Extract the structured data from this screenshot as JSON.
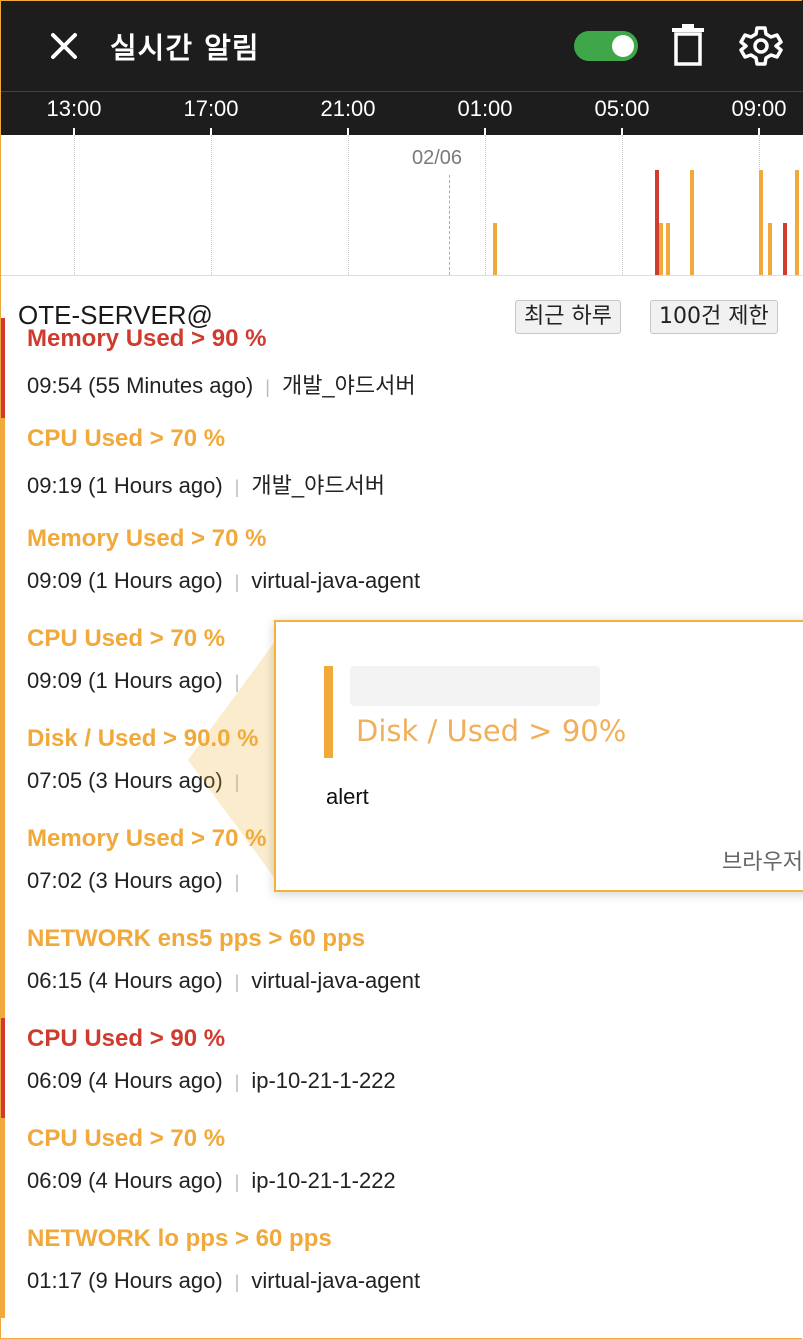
{
  "header": {
    "title": "실시간 알림",
    "close_icon": "close-icon",
    "toggle_on": true,
    "trash_icon": "trash-icon",
    "settings_icon": "gear-icon"
  },
  "timeline": {
    "ticks": [
      "13:00",
      "17:00",
      "21:00",
      "01:00",
      "05:00",
      "09:00"
    ],
    "date_marker": "02/06",
    "colors": {
      "warning": "#f0a93a",
      "critical": "#cf3b2f"
    }
  },
  "server": {
    "name": "OTE-SERVER@",
    "range_button": "최근 하루",
    "limit_button": "100건 제한"
  },
  "alerts": [
    {
      "title": "Memory Used > 90 %",
      "time": "09:54 (55 Minutes ago)",
      "source": "개발_야드서버",
      "level": "critical"
    },
    {
      "title": "CPU Used > 70 %",
      "time": "09:19 (1 Hours ago)",
      "source": "개발_야드서버",
      "level": "warning"
    },
    {
      "title": "Memory Used > 70 %",
      "time": "09:09 (1 Hours ago)",
      "source": "virtual-java-agent",
      "level": "warning"
    },
    {
      "title": "CPU Used > 70 %",
      "time": "09:09 (1 Hours ago)",
      "source": "",
      "level": "warning"
    },
    {
      "title": "Disk / Used > 90.0 %",
      "time": "07:05 (3 Hours ago)",
      "source": "",
      "level": "warning"
    },
    {
      "title": "Memory Used > 70 %",
      "time": "07:02 (3 Hours ago)",
      "source": "",
      "level": "warning"
    },
    {
      "title": "NETWORK ens5 pps > 60 pps",
      "time": "06:15 (4 Hours ago)",
      "source": "virtual-java-agent",
      "level": "warning"
    },
    {
      "title": "CPU Used > 90 %",
      "time": "06:09 (4 Hours ago)",
      "source": "ip-10-21-1-222",
      "level": "critical"
    },
    {
      "title": "CPU Used > 70 %",
      "time": "06:09 (4 Hours ago)",
      "source": "ip-10-21-1-222",
      "level": "warning"
    },
    {
      "title": "NETWORK lo pps > 60 pps",
      "time": "01:17 (9 Hours ago)",
      "source": "virtual-java-agent",
      "level": "warning"
    }
  ],
  "popup": {
    "title": "Disk / Used > 90%",
    "body": "alert",
    "source": "브라우저"
  }
}
